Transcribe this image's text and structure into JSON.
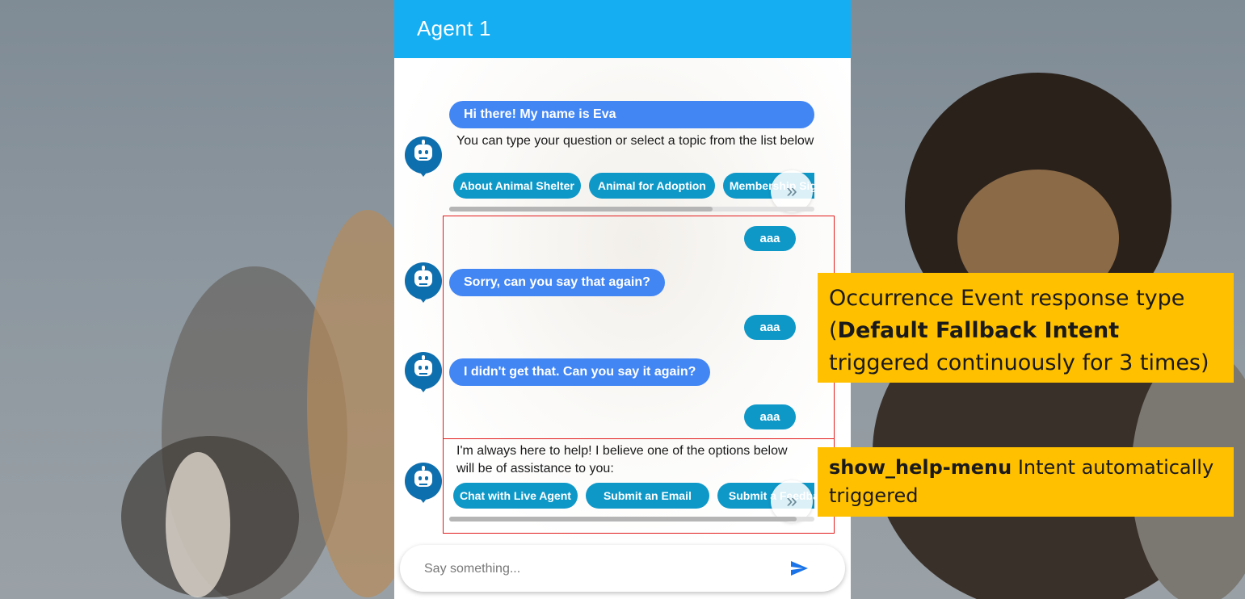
{
  "colors": {
    "header": "#16aef2",
    "bot_bubble": "#4286f4",
    "user_bubble": "#0e98c8",
    "chip": "#0e98c8",
    "highlight_box": "#e21b1b",
    "annotation_bg": "#ffc000",
    "avatar": "#0e6fae"
  },
  "header": {
    "title": "Agent 1"
  },
  "messages": {
    "greeting": {
      "bubble": "Hi there! My name is Eva",
      "text": "You can type your question or select a topic from the list below",
      "chips": [
        "About Animal Shelter",
        "Animal for Adoption",
        "Membership Sign Up"
      ],
      "scroll_icon": "chevron-double-right-icon"
    },
    "user_1": "aaa",
    "bot_1": "Sorry, can you say that again?",
    "user_2": "aaa",
    "bot_2": "I didn't get that. Can you say it again?",
    "user_3": "aaa",
    "help": {
      "text": "I'm always here to help! I believe one of the options below will be of assistance to you:",
      "chips": [
        "Chat with Live Agent",
        "Submit an Email",
        "Submit a Feedback"
      ],
      "scroll_icon": "chevron-double-right-icon"
    }
  },
  "input": {
    "placeholder": "Say something...",
    "send_icon": "send-icon"
  },
  "annotations": {
    "fallback": {
      "line1": "Occurrence Event response type",
      "bold": "Default Fallback Intent",
      "rest": " triggered continuously for 3 times)",
      "open_paren": "("
    },
    "help_menu": {
      "bold": "show_help-menu",
      "rest": " Intent automatically triggered"
    }
  }
}
